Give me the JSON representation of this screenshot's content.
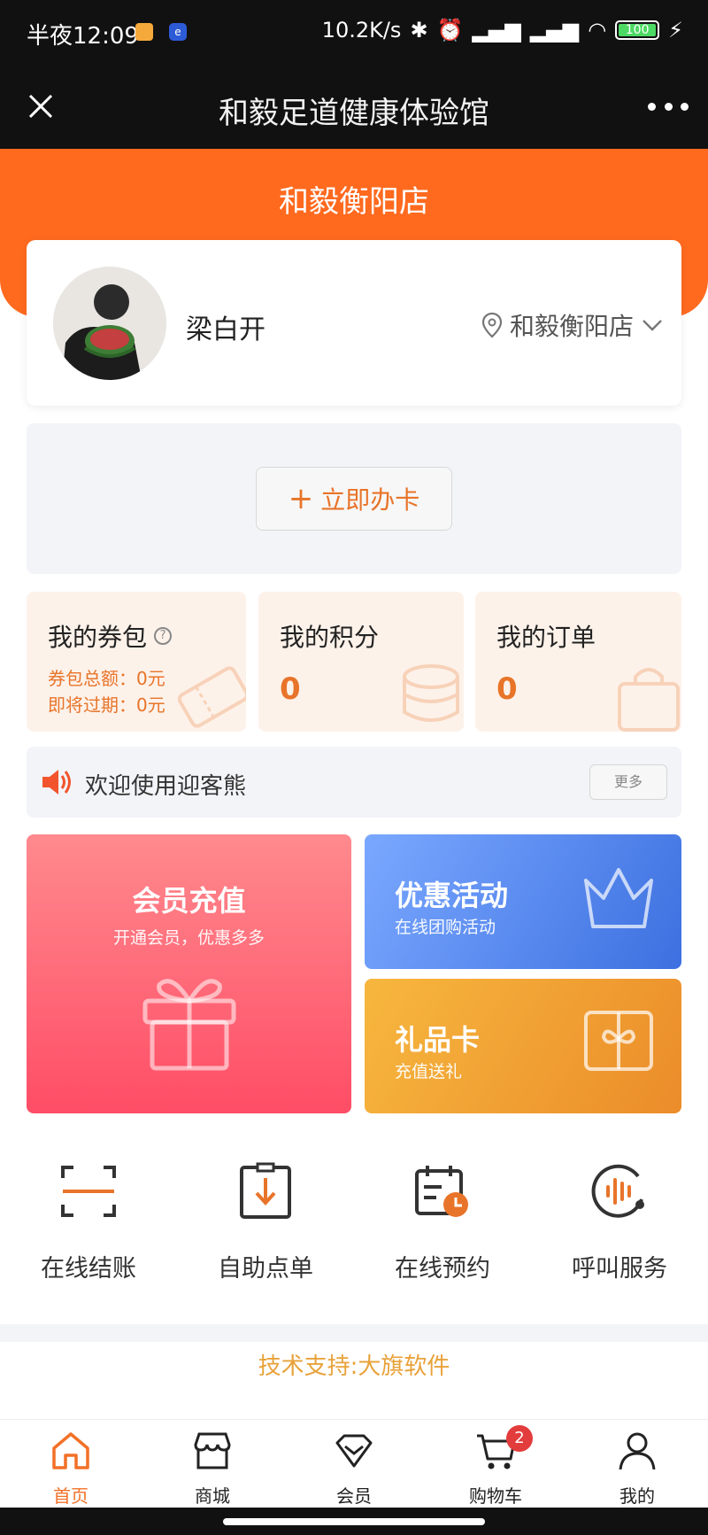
{
  "status_bar": {
    "time": "半夜12:09",
    "net_speed": "10.2K/s",
    "battery": "100"
  },
  "navbar": {
    "title": "和毅足道健康体验馆",
    "close_icon": "close-icon",
    "more_icon": "more-dots-icon"
  },
  "header": {
    "store_title": "和毅衡阳店"
  },
  "profile": {
    "name": "梁白开",
    "store": "和毅衡阳店",
    "location_icon": "location-pin-icon"
  },
  "card": {
    "apply_label": "立即办卡",
    "plus": "+"
  },
  "stats": {
    "coupons": {
      "title": "我的券包",
      "total_label": "券包总额：0元",
      "expiring_label": "即将过期：0元"
    },
    "points": {
      "title": "我的积分",
      "value": "0"
    },
    "orders": {
      "title": "我的订单",
      "value": "0"
    }
  },
  "notice": {
    "text": "欢迎使用迎客熊",
    "more_label": "更多"
  },
  "tiles": {
    "member": {
      "title": "会员充值",
      "subtitle": "开通会员，优惠多多"
    },
    "promo": {
      "title": "优惠活动",
      "subtitle": "在线团购活动"
    },
    "gift": {
      "title": "礼品卡",
      "subtitle": "充值送礼"
    }
  },
  "services": [
    {
      "label": "在线结账",
      "icon": "scan-icon"
    },
    {
      "label": "自助点单",
      "icon": "order-download-icon"
    },
    {
      "label": "在线预约",
      "icon": "calendar-clock-icon"
    },
    {
      "label": "呼叫服务",
      "icon": "call-service-icon"
    }
  ],
  "footer": {
    "support": "技术支持:大旗软件"
  },
  "tabbar": {
    "items": [
      {
        "label": "首页",
        "icon": "home-icon"
      },
      {
        "label": "商城",
        "icon": "shop-icon"
      },
      {
        "label": "会员",
        "icon": "member-icon"
      },
      {
        "label": "购物车",
        "icon": "cart-icon"
      },
      {
        "label": "我的",
        "icon": "user-icon"
      }
    ],
    "cart_badge": "2"
  },
  "colors": {
    "brand_orange": "#ff6a1f",
    "accent_text": "#e8742a",
    "member_tile": "#ff5a6e",
    "promo_tile": "#4f80eb",
    "gift_tile": "#f0a236"
  }
}
